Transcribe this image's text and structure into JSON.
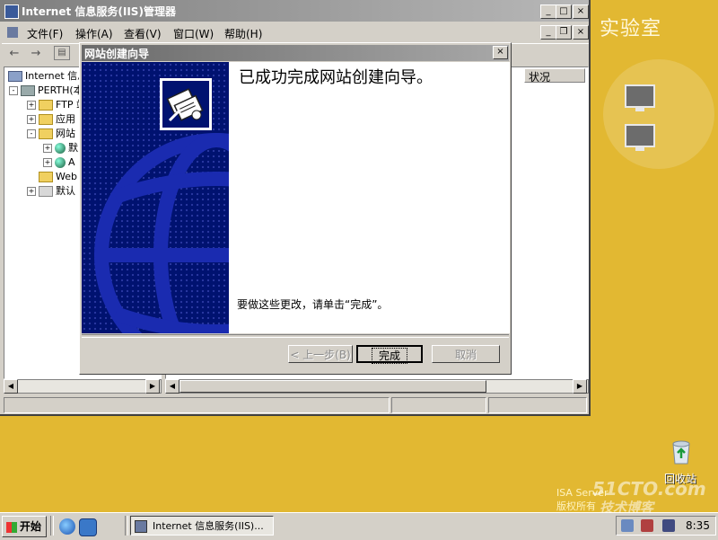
{
  "desktop": {
    "title": "实验室",
    "recycle_bin_label": "回收站",
    "isa_line1": "ISA Server",
    "isa_line2": "版权所有",
    "watermark": "51CTO.com",
    "watermark_sub": "技术博客"
  },
  "iis_window": {
    "title": "Internet 信息服务(IIS)管理器",
    "controls": {
      "minimize": "_",
      "maximize": "□",
      "close": "×"
    },
    "menu": [
      "文件(F)",
      "操作(A)",
      "查看(V)",
      "窗口(W)",
      "帮助(H)"
    ],
    "column_header": "状况",
    "tree": [
      {
        "label": "Internet 信息",
        "expander": ""
      },
      {
        "label": "PERTH(本",
        "expander": "-"
      },
      {
        "label": "FTP 站",
        "expander": "+"
      },
      {
        "label": "应用",
        "expander": "+"
      },
      {
        "label": "网站",
        "expander": "-"
      },
      {
        "label": "默",
        "expander": "+"
      },
      {
        "label": "A",
        "expander": "+"
      },
      {
        "label": "Web",
        "expander": ""
      },
      {
        "label": "默认",
        "expander": "+"
      }
    ]
  },
  "wizard": {
    "title": "网站创建向导",
    "close": "×",
    "heading": "已成功完成网站创建向导。",
    "message": "要做这些更改，请单击“完成”。",
    "buttons": {
      "back": "< 上一步(B)",
      "finish": "完成",
      "cancel": "取消"
    }
  },
  "taskbar": {
    "start_label": "开始",
    "task_label": "Internet 信息服务(IIS)...",
    "clock": "8:35"
  }
}
